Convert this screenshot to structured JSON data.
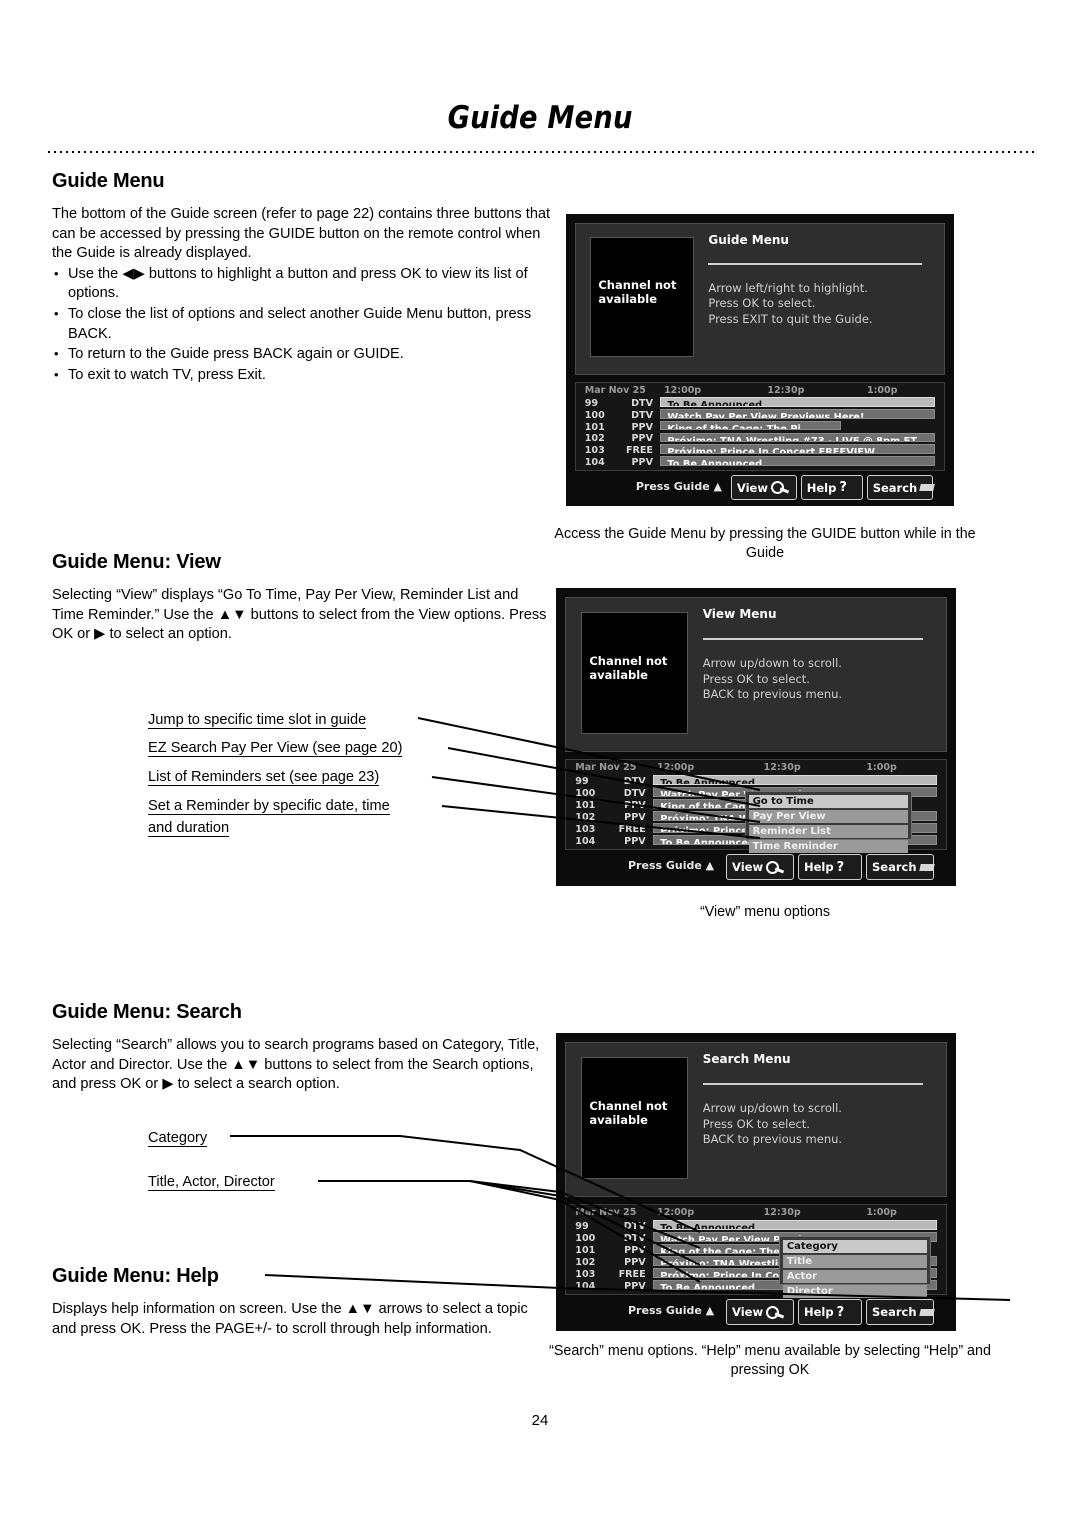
{
  "header": {
    "title": "Guide Menu"
  },
  "folio": "24",
  "sections": {
    "intro": {
      "heading": "Guide Menu",
      "paragraph": "The bottom of the Guide screen (refer to page 22) contains three buttons that can be accessed by pressing the GUIDE button on the remote control when the Guide is already displayed.",
      "bullets": [
        "Use the ◀▶ buttons to highlight a button and press OK to view its list of options.",
        "To close the list of options and select another Guide Menu button, press BACK.",
        "To return to the Guide press BACK again or GUIDE.",
        "To exit to watch TV, press Exit."
      ]
    },
    "view": {
      "heading": "Guide Menu: View",
      "paragraph": "Selecting “View” displays “Go To Time, Pay Per View, Reminder List and Time Reminder.” Use the ▲▼ buttons to select from the View options. Press OK or ▶ to select an option.",
      "callouts": [
        "Jump to specific time slot in guide",
        "EZ Search Pay Per View (see page 20)",
        "List of Reminders set (see page 23)",
        "Set a Reminder by specific date, time",
        "and duration"
      ]
    },
    "search": {
      "heading": "Guide Menu: Search",
      "paragraph": "Selecting “Search” allows you to search programs based on Category, Title, Actor and Director. Use the ▲▼ buttons to select from the Search options, and press OK or ▶ to select a search option.",
      "callouts": [
        "Category",
        "Title, Actor, Director"
      ]
    },
    "help": {
      "heading": "Guide Menu: Help",
      "paragraph": "Displays help information on screen. Use the ▲▼ arrows to select a topic and press OK. Press the PAGE+/- to scroll through help information."
    }
  },
  "captions": {
    "fig1": "Access the Guide Menu by pressing the GUIDE button while in the Guide",
    "fig2": "“View” menu options",
    "fig3": "“Search” menu options. “Help” menu available by selecting “Help” and pressing OK"
  },
  "tv_common": {
    "preview_text_line1": "Channel not",
    "preview_text_line2": "available",
    "timebar": {
      "date": "Mar Nov 25",
      "t1": "12:00p",
      "t2": "12:30p",
      "t3": "1:00p"
    },
    "rows": [
      {
        "num": "99",
        "src": "DTV",
        "title": "To Be Announced",
        "selected": true,
        "short": false
      },
      {
        "num": "100",
        "src": "DTV",
        "title": "Watch Pay Per View Previews Here!",
        "selected": false,
        "short": false
      },
      {
        "num": "101",
        "src": "PPV",
        "title": "King of the Cage: The Pi...",
        "selected": false,
        "short": true
      },
      {
        "num": "102",
        "src": "PPV",
        "title": "Próximo: TNA Wrestling #73 - LIVE @ 8pm ET",
        "selected": false,
        "short": false
      },
      {
        "num": "103",
        "src": "FREE",
        "title": "Próximo: Prince In Concert FREEVIEW",
        "selected": false,
        "short": false
      },
      {
        "num": "104",
        "src": "PPV",
        "title": "To Be Announced",
        "selected": false,
        "short": false
      }
    ],
    "footer": {
      "press_guide": "Press Guide ▲",
      "view": "View",
      "help": "Help",
      "help_mark": "?",
      "search": "Search"
    }
  },
  "tv1": {
    "menu_title": "Guide Menu",
    "menu_lines": [
      "Arrow left/right to highlight.",
      "Press OK to select.",
      "Press EXIT to quit the Guide."
    ]
  },
  "tv2": {
    "menu_title": "View Menu",
    "menu_lines": [
      "Arrow up/down to scroll.",
      "Press OK to select.",
      "BACK to previous menu."
    ],
    "dropdown": [
      {
        "label": "Go to Time",
        "selected": true
      },
      {
        "label": "Pay Per View",
        "selected": false
      },
      {
        "label": "Reminder List",
        "selected": false
      },
      {
        "label": "Time Reminder",
        "selected": false
      }
    ]
  },
  "tv3": {
    "menu_title": "Search Menu",
    "menu_lines": [
      "Arrow up/down to scroll.",
      "Press OK to select.",
      "BACK to previous menu."
    ],
    "dropdown": [
      {
        "label": "Category",
        "selected": true
      },
      {
        "label": "Title",
        "selected": false
      },
      {
        "label": "Actor",
        "selected": false
      },
      {
        "label": "Director",
        "selected": false
      }
    ]
  },
  "colors": {
    "page_bg": "#ffffff",
    "ink": "#000000",
    "tv_bg": "#0b0b0b",
    "tv_panel": "#2e2e2e",
    "tv_row": "#6f6f6f",
    "tv_row_selected": "#b9b9b9"
  }
}
